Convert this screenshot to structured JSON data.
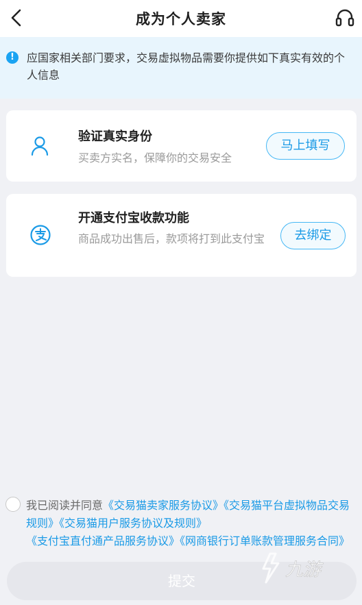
{
  "header": {
    "title": "成为个人卖家",
    "back_icon": "back-arrow-icon",
    "service_icon": "headset-icon"
  },
  "notice": {
    "icon": "info-icon",
    "icon_glyph": "!",
    "text": "应国家相关部门要求，交易虚拟物品需要你提供如下真实有效的个人信息"
  },
  "cards": [
    {
      "icon": "person-icon",
      "title": "验证真实身份",
      "description": "买卖方实名，保障你的交易安全",
      "button": "马上填写"
    },
    {
      "icon": "alipay-icon",
      "title": "开通支付宝收款功能",
      "description": "商品成功出售后，款项将打到此支付宝",
      "button": "去绑定"
    }
  ],
  "agreement": {
    "checked": false,
    "prefix": "我已阅读并同意",
    "links": [
      "《交易猫卖家服务协议》",
      "《交易猫平台虚拟物品交易规则》",
      "《交易猫用户服务协议及规则》",
      "《支付宝直付通产品服务协议》",
      "《网商银行订单账款管理服务合同》"
    ]
  },
  "submit": {
    "label": "提交"
  },
  "colors": {
    "accent": "#1a9ae6",
    "notice_bg": "#e8f5fd",
    "page_bg": "#f0f1f5",
    "submit_disabled_bg": "#e6e7ec"
  }
}
